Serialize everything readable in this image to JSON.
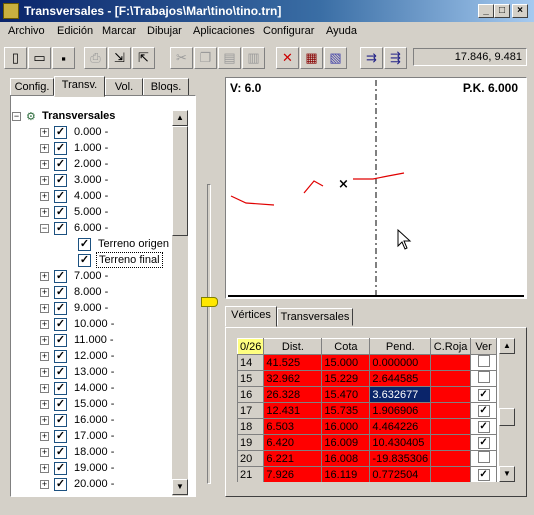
{
  "window": {
    "title": "Transversales - [F:\\Trabajos\\Mar\\tino\\tino.trn]",
    "min": "_",
    "max": "□",
    "close": "×"
  },
  "menu": [
    "Archivo",
    "Edición",
    "Marcar",
    "Dibujar",
    "Aplicaciones",
    "Configurar",
    "Ayuda"
  ],
  "toolbar": {
    "coords": "17.846, 9.481"
  },
  "left_tabs": [
    "Config.",
    "Transv.",
    "Vol.",
    "Bloqs."
  ],
  "tree": {
    "root": "Transversales",
    "items": [
      "0.000 -",
      "1.000 -",
      "2.000 -",
      "3.000 -",
      "4.000 -",
      "5.000 -",
      "6.000 -",
      "7.000 -",
      "8.000 -",
      "9.000 -",
      "10.000 -",
      "11.000 -",
      "12.000 -",
      "13.000 -",
      "14.000 -",
      "15.000 -",
      "16.000 -",
      "17.000 -",
      "18.000 -",
      "19.000 -",
      "20.000 -"
    ],
    "children": [
      "Terreno origen",
      "Terreno final"
    ]
  },
  "drawing": {
    "v_label": "V: 6.0",
    "pk_label": "P.K. 6.000"
  },
  "bottom_tabs": [
    "Vértices",
    "Transversales"
  ],
  "table": {
    "headers": [
      "0/26",
      "Dist.",
      "Cota",
      "Pend.",
      "C.Roja",
      "Ver"
    ],
    "rows": [
      [
        "14",
        "41.525",
        "15.000",
        "0.000000",
        "",
        false
      ],
      [
        "15",
        "32.962",
        "15.229",
        "2.644585",
        "",
        false
      ],
      [
        "16",
        "26.328",
        "15.470",
        "3.632677",
        "",
        true
      ],
      [
        "17",
        "12.431",
        "15.735",
        "1.906906",
        "",
        true
      ],
      [
        "18",
        "6.503",
        "16.000",
        "4.464226",
        "",
        true
      ],
      [
        "19",
        "6.420",
        "16.009",
        "10.430405",
        "",
        true
      ],
      [
        "20",
        "6.221",
        "16.008",
        "-19.835306",
        "",
        false
      ],
      [
        "21",
        "7.926",
        "16.119",
        "0.772504",
        "",
        true
      ]
    ]
  }
}
